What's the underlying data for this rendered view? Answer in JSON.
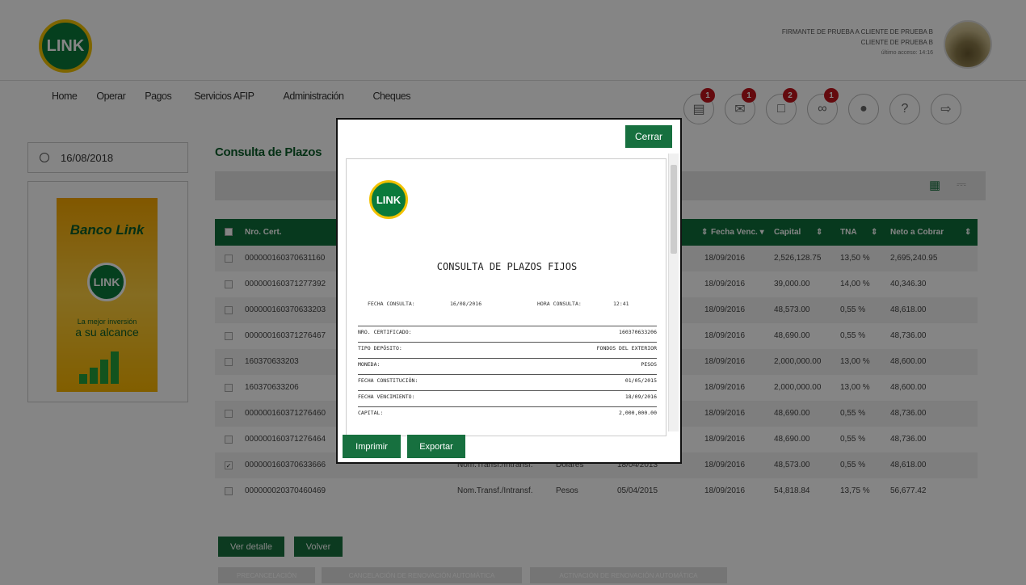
{
  "header": {
    "logo_text": "LINK",
    "user_line1": "FIRMANTE DE PRUEBA A CLIENTE DE PRUEBA B",
    "user_line2": "CLIENTE DE PRUEBA B",
    "last_access": "último acceso: 14:16"
  },
  "nav": [
    "Home",
    "Operar",
    "Pagos",
    "Servicios AFIP",
    "Administración",
    "Cheques"
  ],
  "notifications": [
    {
      "icon": "document-icon",
      "badge": "1"
    },
    {
      "icon": "mail-icon",
      "badge": "1"
    },
    {
      "icon": "message-icon",
      "badge": "2"
    },
    {
      "icon": "attachment-icon",
      "badge": "1"
    },
    {
      "icon": "user-icon",
      "badge": ""
    },
    {
      "icon": "help-icon",
      "badge": ""
    },
    {
      "icon": "logout-icon",
      "badge": ""
    }
  ],
  "sidebar": {
    "date": "16/08/2018",
    "banner": {
      "title": "Banco Link",
      "logo": "LINK",
      "line1": "La mejor inversión",
      "line2": "a su alcance"
    }
  },
  "main": {
    "title": "Consulta de Plazos",
    "columns": {
      "cert": "Nro. Cert.",
      "venc": "Fecha Venc.",
      "capital": "Capital",
      "tna": "TNA",
      "neto": "Neto a Cobrar"
    },
    "rows": [
      {
        "cert": "000000160370631160",
        "tipo": "",
        "moneda": "",
        "fecha": "",
        "venc": "18/09/2016",
        "capital": "2,526,128.75",
        "tna": "13,50 %",
        "neto": "2,695,240.95",
        "checked": false
      },
      {
        "cert": "000000160371277392",
        "tipo": "",
        "moneda": "",
        "fecha": "",
        "venc": "18/09/2016",
        "capital": "39,000.00",
        "tna": "14,00 %",
        "neto": "40,346.30",
        "checked": false
      },
      {
        "cert": "000000160370633203",
        "tipo": "",
        "moneda": "",
        "fecha": "",
        "venc": "18/09/2016",
        "capital": "48,573.00",
        "tna": "0,55 %",
        "neto": "48,618.00",
        "checked": false
      },
      {
        "cert": "000000160371276467",
        "tipo": "",
        "moneda": "",
        "fecha": "",
        "venc": "18/09/2016",
        "capital": "48,690.00",
        "tna": "0,55 %",
        "neto": "48,736.00",
        "checked": false
      },
      {
        "cert": "160370633203",
        "tipo": "",
        "moneda": "",
        "fecha": "",
        "venc": "18/09/2016",
        "capital": "2,000,000.00",
        "tna": "13,00 %",
        "neto": "48,600.00",
        "checked": false
      },
      {
        "cert": "160370633206",
        "tipo": "",
        "moneda": "",
        "fecha": "",
        "venc": "18/09/2016",
        "capital": "2,000,000.00",
        "tna": "13,00 %",
        "neto": "48,600.00",
        "checked": false
      },
      {
        "cert": "000000160371276460",
        "tipo": "",
        "moneda": "",
        "fecha": "",
        "venc": "18/09/2016",
        "capital": "48,690.00",
        "tna": "0,55 %",
        "neto": "48,736.00",
        "checked": false
      },
      {
        "cert": "000000160371276464",
        "tipo": "",
        "moneda": "",
        "fecha": "",
        "venc": "18/09/2016",
        "capital": "48,690.00",
        "tna": "0,55 %",
        "neto": "48,736.00",
        "checked": false
      },
      {
        "cert": "000000160370633666",
        "tipo": "Nom.Transf./Intransf.",
        "moneda": "Dólares",
        "fecha": "18/04/2013",
        "venc": "18/09/2016",
        "capital": "48,573.00",
        "tna": "0,55 %",
        "neto": "48,618.00",
        "checked": true
      },
      {
        "cert": "000000020370460469",
        "tipo": "Nom.Transf./Intransf.",
        "moneda": "Pesos",
        "fecha": "05/04/2015",
        "venc": "18/09/2016",
        "capital": "54,818.84",
        "tna": "13,75 %",
        "neto": "56,677.42",
        "checked": false
      }
    ],
    "btn_detalle": "Ver detalle",
    "btn_volver": "Volver",
    "disabled_buttons": [
      "PRECANCELACIÓN",
      "CANCELACIÓN DE RENOVACIÓN AUTOMÁTICA",
      "ACTIVACIÓN DE RENOVACIÓN AUTOMÁTICA"
    ]
  },
  "modal": {
    "close": "Cerrar",
    "logo": "LINK",
    "doc_title": "CONSULTA DE PLAZOS FIJOS",
    "fecha_label": "FECHA CONSULTA:",
    "fecha_value": "16/08/2016",
    "hora_label": "HORA CONSULTA:",
    "hora_value": "12:41",
    "fields": [
      {
        "label": "NRO. CERTIFICADO:",
        "value": "160370633206"
      },
      {
        "label": "TIPO DEPÓSITO:",
        "value": "FONDOS DEL EXTERIOR"
      },
      {
        "label": "MONEDA:",
        "value": "PESOS"
      },
      {
        "label": "FECHA CONSTITUCIÓN:",
        "value": "01/05/2015"
      },
      {
        "label": "FECHA VENCIMIENTO:",
        "value": "18/09/2016"
      },
      {
        "label": "CAPITAL:",
        "value": "2,000,000.00"
      }
    ],
    "btn_print": "Imprimir",
    "btn_export": "Exportar"
  }
}
